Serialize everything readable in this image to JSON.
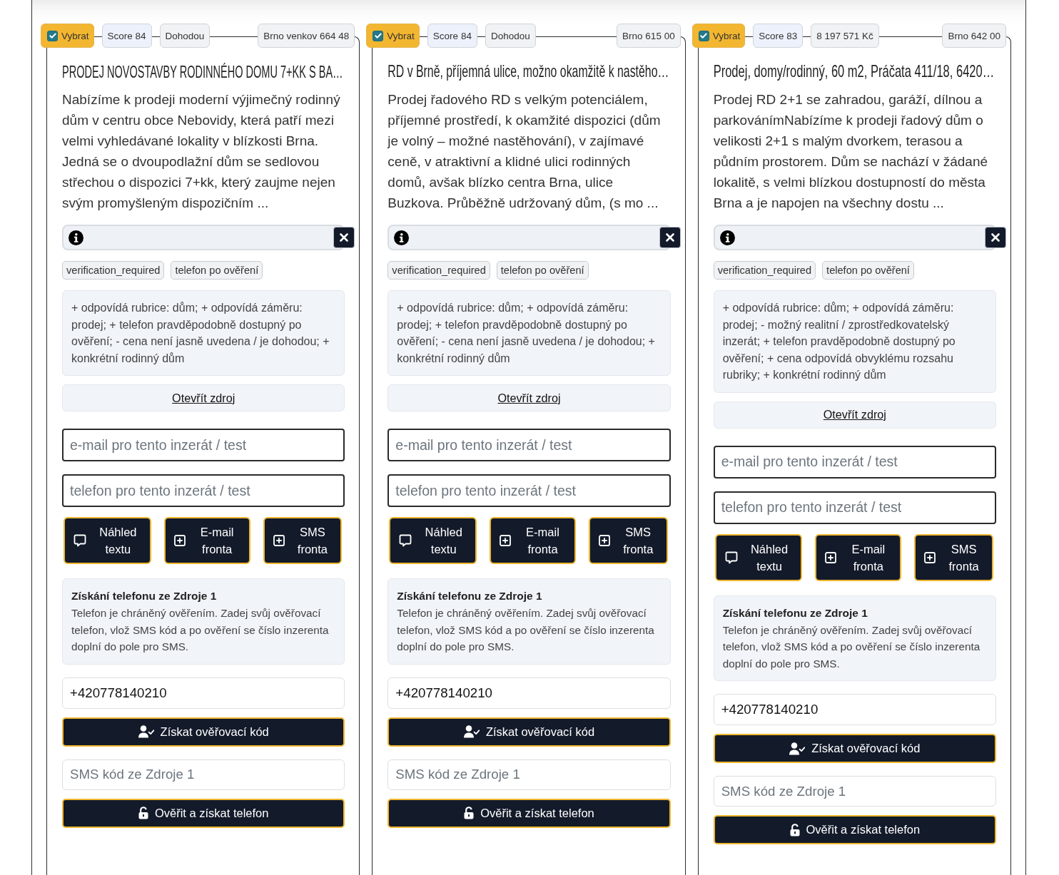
{
  "cards": [
    {
      "select": {
        "label": "Vybrat",
        "checked": true
      },
      "score": "Score 84",
      "price": "Dohodou",
      "location": "Brno venkov 664 48",
      "title": "PRODEJ NOVOSTAVBY RODINNÉHO DOMU 7+KK S BA…",
      "description": "Nabízíme k prodeji moderní výjimečný rodinný dům v centru obce Nebovidy, která patří mezi velmi vyhledávané lokality v blízkosti Brna. Jedná se o dvoupodlažní dům se sedlovou střechou o dispozici 7+kk, který zaujme nejen svým promyšleným dispozičním ...",
      "tags": [
        "verification_required",
        "telefon po ověření"
      ],
      "notes": "+ odpovídá rubrice: dům; + odpovídá záměru: prodej; + telefon pravděpodobně dostupný po ověření; - cena není jasně uvedena / je dohodou; + konkrétní rodinný dům",
      "source_link": "Otevřít zdroj",
      "email_field": {
        "placeholder": "e-mail pro tento inzerát / test"
      },
      "phone_field": {
        "placeholder": "telefon pro tento inzerát / test"
      },
      "actions": [
        {
          "kind": "preview",
          "label": "Náhled textu"
        },
        {
          "kind": "queue",
          "label": "E-mail fronta"
        },
        {
          "kind": "queue",
          "label": "SMS fronta"
        }
      ],
      "verification": {
        "heading": "Získání telefonu ze Zdroje 1",
        "text": "Telefon je chráněný ověřením. Zadej svůj ověřovací telefon, vlož SMS kód a po ověření se číslo inzerenta doplní do pole pro SMS.",
        "phone_field": {
          "value": "+420778140210"
        },
        "request_button": "Získat ověřovací kód",
        "code_field": {
          "placeholder": "SMS kód ze Zdroje 1"
        },
        "verify_button": "Ověřit a získat telefon"
      }
    },
    {
      "select": {
        "label": "Vybrat",
        "checked": true
      },
      "score": "Score 84",
      "price": "Dohodou",
      "location": "Brno 615 00",
      "title": "RD v Brně, příjemná ulice, možno okamžitě k nastěho…",
      "description": "Prodej řadového RD s velkým potenciálem, příjemné prostředí, k okamžité dispozici (dům je volný – možné nastěhování), v zajímavé ceně, v atraktivní a klidné ulici rodinných domů, avšak blízko centra Brna, ulice Buzkova. Průběžně udržovaný dům, (s mo ...",
      "tags": [
        "verification_required",
        "telefon po ověření"
      ],
      "notes": "+ odpovídá rubrice: dům; + odpovídá záměru: prodej; + telefon pravděpodobně dostupný po ověření; - cena není jasně uvedena / je dohodou; + konkrétní rodinný dům",
      "source_link": "Otevřít zdroj",
      "email_field": {
        "placeholder": "e-mail pro tento inzerát / test"
      },
      "phone_field": {
        "placeholder": "telefon pro tento inzerát / test"
      },
      "actions": [
        {
          "kind": "preview",
          "label": "Náhled textu"
        },
        {
          "kind": "queue",
          "label": "E-mail fronta"
        },
        {
          "kind": "queue",
          "label": "SMS fronta"
        }
      ],
      "verification": {
        "heading": "Získání telefonu ze Zdroje 1",
        "text": "Telefon je chráněný ověřením. Zadej svůj ověřovací telefon, vlož SMS kód a po ověření se číslo inzerenta doplní do pole pro SMS.",
        "phone_field": {
          "value": "+420778140210"
        },
        "request_button": "Získat ověřovací kód",
        "code_field": {
          "placeholder": "SMS kód ze Zdroje 1"
        },
        "verify_button": "Ověřit a získat telefon"
      }
    },
    {
      "select": {
        "label": "Vybrat",
        "checked": true
      },
      "score": "Score 83",
      "price": "8 197 571 Kč",
      "location": "Brno 642 00",
      "title": "Prodej, domy/rodinný, 60 m2, Práčata 411/18, 6420…",
      "description": "Prodej RD 2+1 se zahradou, garáží, dílnou a parkovánímNabízíme k prodeji řadový dům o velikosti 2+1 s malým dvorkem, terasou a půdním prostorem. Dům se nachází v žádané lokalitě, s velmi blízkou dostupností do města Brna a je napojen na všechny dostu ...",
      "tags": [
        "verification_required",
        "telefon po ověření"
      ],
      "notes": "+ odpovídá rubrice: dům; + odpovídá záměru: prodej; - možný realitní / zprostředkovatelský inzerát; + telefon pravděpodobně dostupný po ověření; + cena odpovídá obvyklému rozsahu rubriky; + konkrétní rodinný dům",
      "source_link": "Otevřít zdroj",
      "email_field": {
        "placeholder": "e-mail pro tento inzerát / test"
      },
      "phone_field": {
        "placeholder": "telefon pro tento inzerát / test"
      },
      "actions": [
        {
          "kind": "preview",
          "label": "Náhled textu"
        },
        {
          "kind": "queue",
          "label": "E-mail fronta"
        },
        {
          "kind": "queue",
          "label": "SMS fronta"
        }
      ],
      "verification": {
        "heading": "Získání telefonu ze Zdroje 1",
        "text": "Telefon je chráněný ověřením. Zadej svůj ověřovací telefon, vlož SMS kód a po ověření se číslo inzerenta doplní do pole pro SMS.",
        "phone_field": {
          "value": "+420778140210"
        },
        "request_button": "Získat ověřovací kód",
        "code_field": {
          "placeholder": "SMS kód ze Zdroje 1"
        },
        "verify_button": "Ověřit a získat telefon"
      }
    }
  ]
}
